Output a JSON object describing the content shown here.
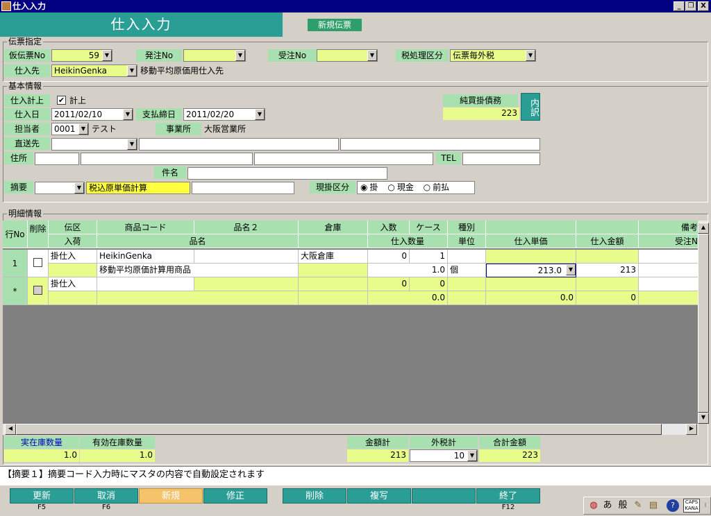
{
  "window": {
    "title": "仕入入力",
    "btn_min": "_",
    "btn_max": "❐",
    "btn_close": "X"
  },
  "header": {
    "title": "仕入入力",
    "new_slip": "新規伝票"
  },
  "slip": {
    "legend": "伝票指定",
    "temp_no_label": "仮伝票No",
    "temp_no": "59",
    "order_no_label": "発注No",
    "order_no": "",
    "recv_no_label": "受注No",
    "recv_no": "",
    "tax_label": "税処理区分",
    "tax": "伝票毎外税",
    "supplier_label": "仕入先",
    "supplier_code": "HeikinGenka",
    "supplier_name": "移動平均原価用仕入先"
  },
  "basic": {
    "legend": "基本情報",
    "post_label": "仕入計上",
    "post_check": "計上",
    "date_label": "仕入日",
    "date": "2011/02/10",
    "close_label": "支払締日",
    "close_date": "2011/02/20",
    "staff_label": "担当者",
    "staff_code": "0001",
    "staff_name": "テスト",
    "office_label": "事業所",
    "office": "大阪営業所",
    "ship_label": "直送先",
    "address_label": "住所",
    "tel_label": "TEL",
    "subject_label": "件名",
    "memo_label": "摘要",
    "memo_text": "税込原単価計算",
    "pay_label": "現掛区分",
    "pay_opts": [
      "掛",
      "現金",
      "前払"
    ],
    "payable_label": "純買掛債務",
    "payable": "223",
    "detail_btn": "内訳"
  },
  "detail": {
    "legend": "明細情報",
    "head1": [
      "行No",
      "削除",
      "伝区",
      "商品コード",
      "品名２",
      "倉庫",
      "入数",
      "ケース",
      "種別",
      "",
      "",
      "備考"
    ],
    "head2": [
      "入荷",
      "品名",
      "仕入数量",
      "単位",
      "仕入単価",
      "仕入金額",
      "受注N"
    ],
    "rows": [
      {
        "no": "1",
        "kind": "掛仕入",
        "code": "HeikinGenka",
        "name2": "",
        "wh": "大阪倉庫",
        "irisu": "0",
        "case": "1",
        "name": "移動平均原価計算用商品",
        "qty": "1.0",
        "unit": "個",
        "price": "213.0",
        "amount": "213"
      },
      {
        "no": "*",
        "kind": "掛仕入",
        "code": "",
        "name2": "",
        "wh": "",
        "irisu": "0",
        "case": "0",
        "name": "",
        "qty": "0.0",
        "unit": "",
        "price": "0.0",
        "amount": "0"
      }
    ]
  },
  "stock": {
    "actual_label": "実在庫数量",
    "actual": "1.0",
    "avail_label": "有効在庫数量",
    "avail": "1.0"
  },
  "totals": {
    "amount_label": "金額計",
    "amount": "213",
    "tax_label": "外税計",
    "tax": "10",
    "total_label": "合計金額",
    "total": "223"
  },
  "status": "【摘要１】摘要コード入力時にマスタの内容で自動設定されます",
  "fkeys": [
    {
      "label": "更新",
      "key": "F5"
    },
    {
      "label": "取消",
      "key": "F6"
    },
    {
      "label": "新規",
      "key": ""
    },
    {
      "label": "修正",
      "key": ""
    },
    {
      "label": "削除",
      "key": ""
    },
    {
      "label": "複写",
      "key": ""
    },
    {
      "label": "",
      "key": ""
    },
    {
      "label": "終了",
      "key": "F12"
    }
  ],
  "tray": {
    "ime": "あ",
    "mode": "般",
    "caps": "CAPS",
    "kana": "KANA"
  },
  "colors": {
    "teal": "#2a9d94",
    "label_green": "#a8e0b0",
    "input_yellow": "#e8fc8c",
    "new_btn_orange": "#f5c46a"
  }
}
